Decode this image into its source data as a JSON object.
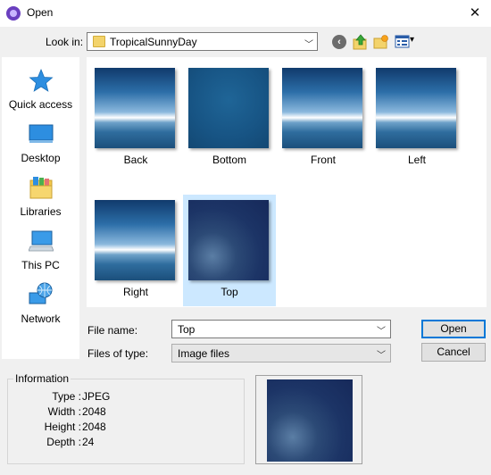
{
  "window": {
    "title": "Open",
    "close_glyph": "✕",
    "icon": "app-icon"
  },
  "lookin": {
    "label": "Look in:",
    "value": "TropicalSunnyDay"
  },
  "toolbar": {
    "back_glyph": "‹",
    "view_arrow": "▾"
  },
  "places": [
    {
      "label": "Quick access",
      "icon": "star-icon"
    },
    {
      "label": "Desktop",
      "icon": "desktop-icon"
    },
    {
      "label": "Libraries",
      "icon": "libraries-icon"
    },
    {
      "label": "This PC",
      "icon": "computer-icon"
    },
    {
      "label": "Network",
      "icon": "network-icon"
    }
  ],
  "files": [
    {
      "name": "Back"
    },
    {
      "name": "Bottom"
    },
    {
      "name": "Front"
    },
    {
      "name": "Left"
    },
    {
      "name": "Right"
    },
    {
      "name": "Top",
      "selected": true
    }
  ],
  "filename": {
    "label": "File name:",
    "value": "Top"
  },
  "filetype": {
    "label": "Files of type:",
    "value": "Image files"
  },
  "buttons": {
    "open": "Open",
    "cancel": "Cancel"
  },
  "info": {
    "title": "Information",
    "rows": [
      {
        "key": "Type :",
        "value": "JPEG"
      },
      {
        "key": "Width :",
        "value": "2048"
      },
      {
        "key": "Height :",
        "value": "2048"
      },
      {
        "key": "Depth :",
        "value": "24"
      }
    ]
  },
  "colors": {
    "accent": "#0078d7",
    "selection": "#cce8ff"
  }
}
